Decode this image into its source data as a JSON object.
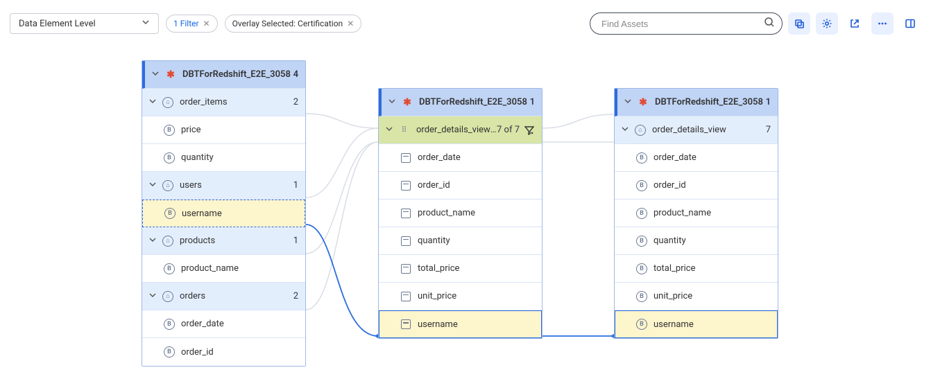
{
  "toolbar": {
    "level_select": "Data Element Level",
    "filter_chip": "1 Filter",
    "overlay_chip": "Overlay Selected: Certification",
    "search_placeholder": "Find Assets"
  },
  "nodes": {
    "n1": {
      "title": "DBTForRedshift_E2E_3058",
      "count": "4",
      "groups": [
        {
          "name": "order_items",
          "count": "2",
          "cols": [
            "price",
            "quantity"
          ]
        },
        {
          "name": "users",
          "count": "1",
          "cols": [
            "username"
          ],
          "selected": true
        },
        {
          "name": "products",
          "count": "1",
          "cols": [
            "product_name"
          ]
        },
        {
          "name": "orders",
          "count": "2",
          "cols": [
            "order_date",
            "order_id"
          ]
        }
      ]
    },
    "n2": {
      "title": "DBTForRedshift_E2E_3058",
      "count": "1",
      "group": {
        "name": "order_details_view …",
        "count": "7 of 7"
      },
      "cols": [
        "order_date",
        "order_id",
        "product_name",
        "quantity",
        "total_price",
        "unit_price",
        "username"
      ]
    },
    "n3": {
      "title": "DBTForRedshift_E2E_3058",
      "count": "1",
      "group": {
        "name": "order_details_view",
        "count": "7"
      },
      "cols": [
        "order_date",
        "order_id",
        "product_name",
        "quantity",
        "total_price",
        "unit_price",
        "username"
      ]
    }
  }
}
